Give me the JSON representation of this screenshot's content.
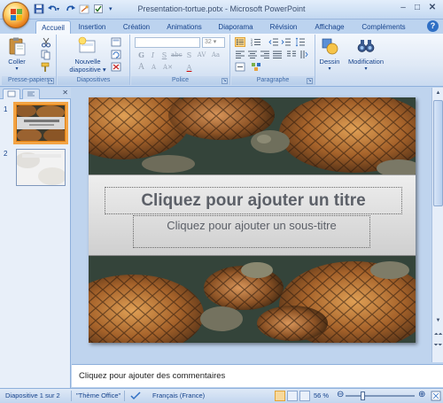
{
  "window": {
    "title": "Presentation-tortue.potx - Microsoft PowerPoint"
  },
  "tabs": [
    {
      "label": "Accueil",
      "active": true
    },
    {
      "label": "Insertion"
    },
    {
      "label": "Création"
    },
    {
      "label": "Animations"
    },
    {
      "label": "Diaporama"
    },
    {
      "label": "Révision"
    },
    {
      "label": "Affichage"
    },
    {
      "label": "Compléments"
    }
  ],
  "ribbon": {
    "clipboard": {
      "label": "Presse-papiers",
      "paste": "Coller"
    },
    "slides": {
      "label": "Diapositives",
      "new_slide_line1": "Nouvelle",
      "new_slide_line2": "diapositive"
    },
    "font": {
      "label": "Police",
      "font_size": "32"
    },
    "paragraph": {
      "label": "Paragraphe"
    },
    "drawing": {
      "label": "Dessin"
    },
    "editing": {
      "label": "Modification"
    }
  },
  "slides_panel": {
    "thumbs": [
      {
        "number": "1",
        "selected": true
      },
      {
        "number": "2",
        "selected": false
      }
    ]
  },
  "slide": {
    "title_placeholder": "Cliquez pour ajouter un titre",
    "subtitle_placeholder": "Cliquez pour ajouter un sous-titre"
  },
  "notes": {
    "placeholder": "Cliquez pour ajouter des commentaires"
  },
  "status": {
    "slide_info": "Diapositive 1 sur 2",
    "theme": "\"Thème Office\"",
    "language": "Français (France)",
    "zoom": "56 %",
    "zoom_level_percent": 56
  },
  "colors": {
    "accent": "#f3a445",
    "ribbon_text": "#15428b",
    "frame": "#bfd4ee"
  }
}
